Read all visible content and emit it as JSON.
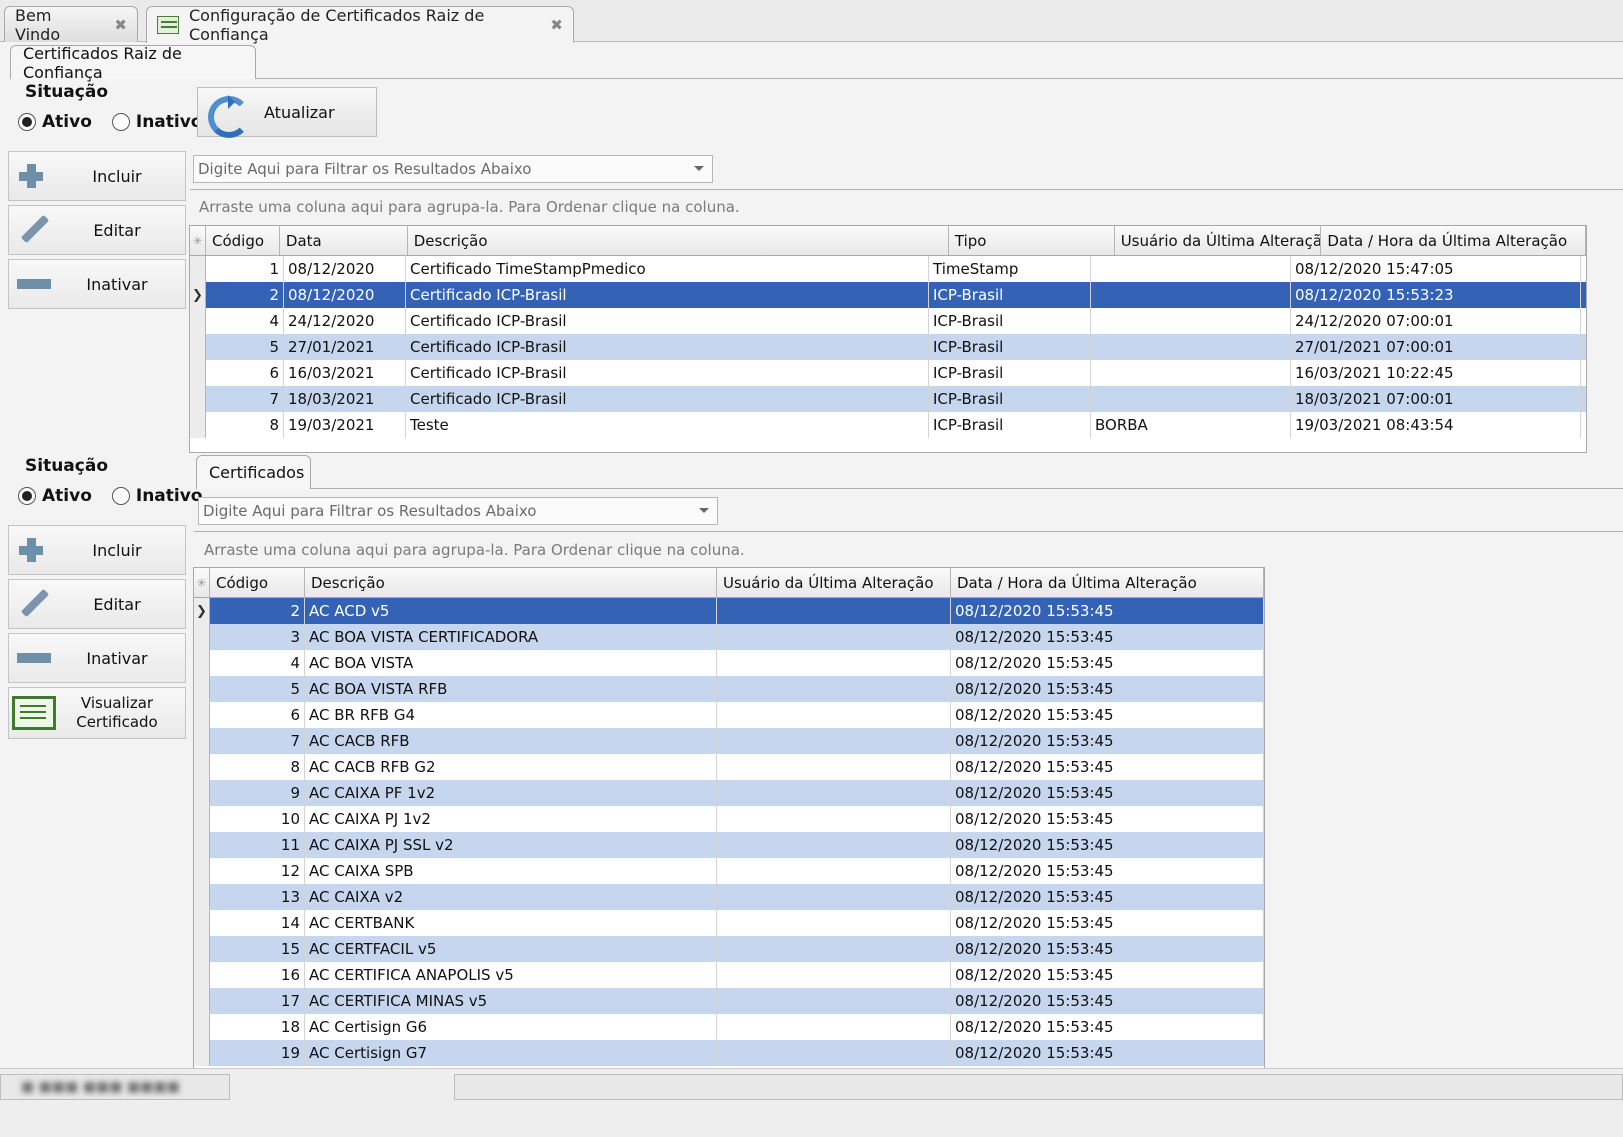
{
  "tabs": {
    "welcome": "Bem Vindo",
    "config": "Configuração de Certificados Raiz de Confiança"
  },
  "top_section": {
    "tab": "Certificados Raiz de Confiança",
    "situacao": "Situação",
    "ativo": "Ativo",
    "inativo": "Inativo",
    "selected_status": "Ativo",
    "incluir": "Incluir",
    "editar": "Editar",
    "inativar": "Inativar",
    "atualizar": "Atualizar",
    "filter_placeholder": "Digite Aqui para Filtrar os Resultados Abaixo",
    "group_hint": "Arraste uma coluna aqui para agrupa-la. Para Ordenar clique na coluna.",
    "columns": [
      "Código",
      "Data",
      "Descrição",
      "Tipo",
      "Usuário da Última Alteraçã",
      "Data / Hora da Última Alteração"
    ],
    "rows": [
      {
        "codigo": "1",
        "data": "08/12/2020",
        "descricao": "Certificado TimeStampPmedico",
        "tipo": "TimeStamp",
        "usuario": "",
        "data_hora": "08/12/2020 15:47:05"
      },
      {
        "codigo": "2",
        "data": "08/12/2020",
        "descricao": "Certificado ICP-Brasil",
        "tipo": "ICP-Brasil",
        "usuario": "",
        "data_hora": "08/12/2020 15:53:23"
      },
      {
        "codigo": "4",
        "data": "24/12/2020",
        "descricao": "Certificado ICP-Brasil",
        "tipo": "ICP-Brasil",
        "usuario": "",
        "data_hora": "24/12/2020 07:00:01"
      },
      {
        "codigo": "5",
        "data": "27/01/2021",
        "descricao": "Certificado ICP-Brasil",
        "tipo": "ICP-Brasil",
        "usuario": "",
        "data_hora": "27/01/2021 07:00:01"
      },
      {
        "codigo": "6",
        "data": "16/03/2021",
        "descricao": "Certificado ICP-Brasil",
        "tipo": "ICP-Brasil",
        "usuario": "",
        "data_hora": "16/03/2021 10:22:45"
      },
      {
        "codigo": "7",
        "data": "18/03/2021",
        "descricao": "Certificado ICP-Brasil",
        "tipo": "ICP-Brasil",
        "usuario": "",
        "data_hora": "18/03/2021 07:00:01"
      },
      {
        "codigo": "8",
        "data": "19/03/2021",
        "descricao": "Teste",
        "tipo": "ICP-Brasil",
        "usuario": "BORBA",
        "data_hora": "19/03/2021 08:43:54"
      }
    ]
  },
  "bottom_section": {
    "tab": "Certificados",
    "situacao": "Situação",
    "ativo": "Ativo",
    "inativo": "Inativo",
    "selected_status": "Ativo",
    "incluir": "Incluir",
    "editar": "Editar",
    "inativar": "Inativar",
    "visualizar": "Visualizar Certificado",
    "filter_placeholder": "Digite Aqui para Filtrar os Resultados Abaixo",
    "group_hint": "Arraste uma coluna aqui para agrupa-la. Para Ordenar clique na coluna.",
    "columns": [
      "Código",
      "Descrição",
      "Usuário da Última Alteração",
      "Data / Hora da Última Alteração"
    ],
    "rows": [
      {
        "codigo": "2",
        "descricao": "AC ACD v5",
        "usuario": "",
        "data_hora": "08/12/2020 15:53:45"
      },
      {
        "codigo": "3",
        "descricao": "AC BOA VISTA CERTIFICADORA",
        "usuario": "",
        "data_hora": "08/12/2020 15:53:45"
      },
      {
        "codigo": "4",
        "descricao": "AC BOA VISTA",
        "usuario": "",
        "data_hora": "08/12/2020 15:53:45"
      },
      {
        "codigo": "5",
        "descricao": "AC BOA VISTA RFB",
        "usuario": "",
        "data_hora": "08/12/2020 15:53:45"
      },
      {
        "codigo": "6",
        "descricao": "AC BR RFB G4",
        "usuario": "",
        "data_hora": "08/12/2020 15:53:45"
      },
      {
        "codigo": "7",
        "descricao": "AC CACB RFB",
        "usuario": "",
        "data_hora": "08/12/2020 15:53:45"
      },
      {
        "codigo": "8",
        "descricao": "AC CACB RFB G2",
        "usuario": "",
        "data_hora": "08/12/2020 15:53:45"
      },
      {
        "codigo": "9",
        "descricao": "AC CAIXA PF 1v2",
        "usuario": "",
        "data_hora": "08/12/2020 15:53:45"
      },
      {
        "codigo": "10",
        "descricao": "AC CAIXA PJ 1v2",
        "usuario": "",
        "data_hora": "08/12/2020 15:53:45"
      },
      {
        "codigo": "11",
        "descricao": "AC CAIXA PJ SSL v2",
        "usuario": "",
        "data_hora": "08/12/2020 15:53:45"
      },
      {
        "codigo": "12",
        "descricao": "AC CAIXA SPB",
        "usuario": "",
        "data_hora": "08/12/2020 15:53:45"
      },
      {
        "codigo": "13",
        "descricao": "AC CAIXA v2",
        "usuario": "",
        "data_hora": "08/12/2020 15:53:45"
      },
      {
        "codigo": "14",
        "descricao": "AC CERTBANK",
        "usuario": "",
        "data_hora": "08/12/2020 15:53:45"
      },
      {
        "codigo": "15",
        "descricao": "AC CERTFACIL v5",
        "usuario": "",
        "data_hora": "08/12/2020 15:53:45"
      },
      {
        "codigo": "16",
        "descricao": "AC CERTIFICA ANAPOLIS v5",
        "usuario": "",
        "data_hora": "08/12/2020 15:53:45"
      },
      {
        "codigo": "17",
        "descricao": "AC CERTIFICA MINAS v5",
        "usuario": "",
        "data_hora": "08/12/2020 15:53:45"
      },
      {
        "codigo": "18",
        "descricao": "AC Certisign G6",
        "usuario": "",
        "data_hora": "08/12/2020 15:53:45"
      },
      {
        "codigo": "19",
        "descricao": "AC Certisign G7",
        "usuario": "",
        "data_hora": "08/12/2020 15:53:45"
      }
    ]
  },
  "colors": {
    "selection": "#3463b6",
    "alt_row": "#c6d6ee"
  }
}
